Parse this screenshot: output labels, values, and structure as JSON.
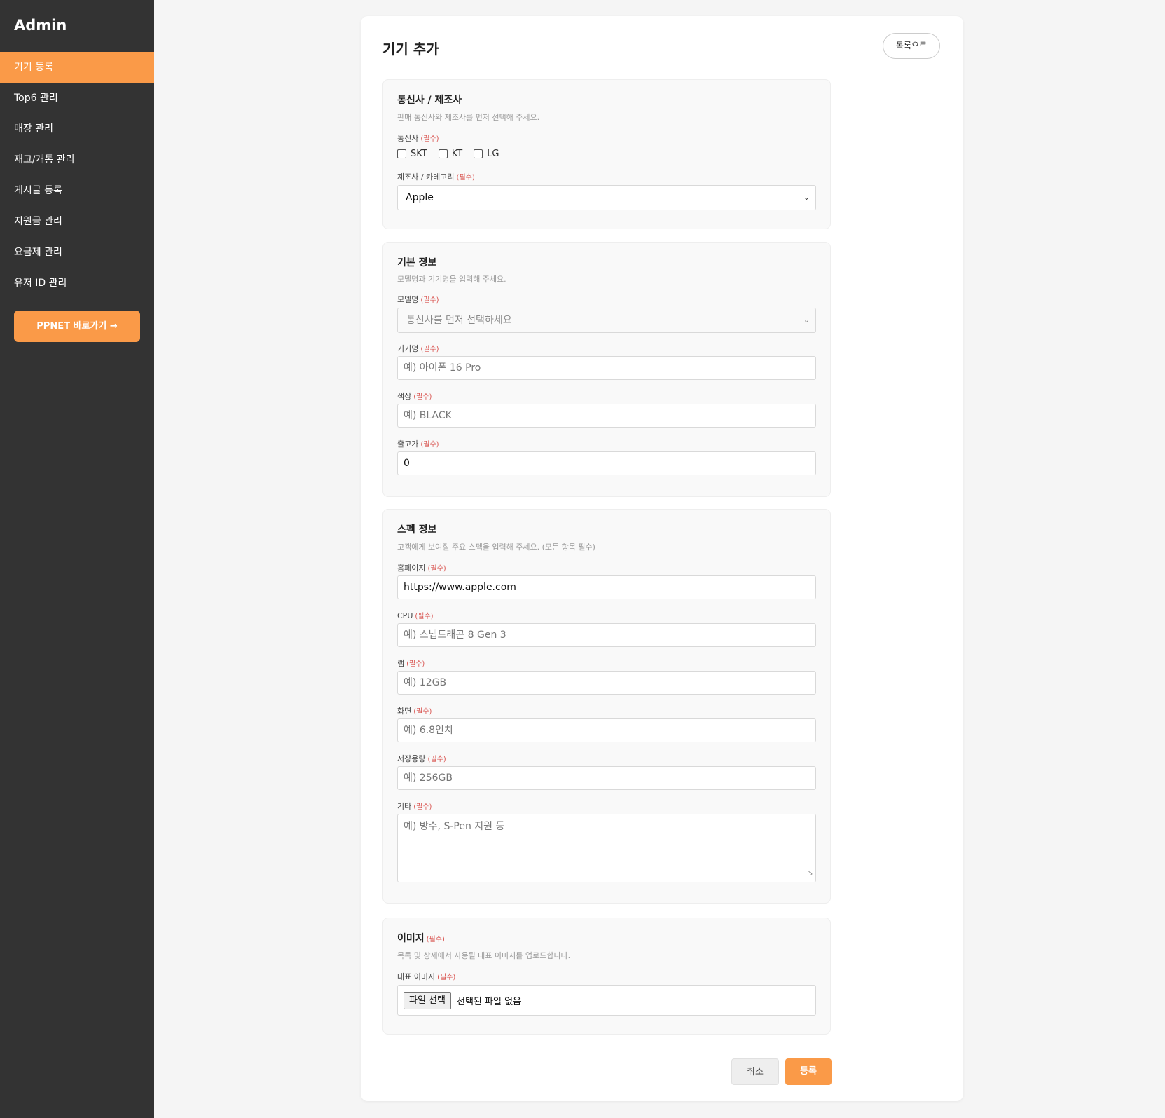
{
  "sidebar": {
    "brand": "Admin",
    "items": [
      {
        "label": "기기 등록"
      },
      {
        "label": "Top6 관리"
      },
      {
        "label": "매장 관리"
      },
      {
        "label": "재고/개통 관리"
      },
      {
        "label": "게시글 등록"
      },
      {
        "label": "지원금 관리"
      },
      {
        "label": "요금제 관리"
      },
      {
        "label": "유저 ID 관리"
      }
    ],
    "ppnet_button": "PPNET 바로가기 →"
  },
  "header": {
    "title": "기기 추가",
    "back_label": "목록으로"
  },
  "required_mark": "(필수)",
  "carrier_section": {
    "title": "통신사 / 제조사",
    "desc": "판매 통신사와 제조사를 먼저 선택해 주세요.",
    "carrier_label": "통신사",
    "carriers": [
      "SKT",
      "KT",
      "LG"
    ],
    "maker_label": "제조사 / 카테고리",
    "maker_value": "Apple"
  },
  "basic_section": {
    "title": "기본 정보",
    "desc": "모델명과 기기명을 입력해 주세요.",
    "model_label": "모델명",
    "model_value": "통신사를 먼저 선택하세요",
    "name_label": "기기명",
    "name_placeholder": "예) 아이폰 16 Pro",
    "color_label": "색상",
    "color_placeholder": "예) BLACK",
    "price_label": "출고가",
    "price_value": "0"
  },
  "spec_section": {
    "title": "스펙 정보",
    "desc": "고객에게 보여질 주요 스펙을 입력해 주세요. (모든 항목 필수)",
    "homepage_label": "홈페이지",
    "homepage_value": "https://www.apple.com",
    "cpu_label": "CPU",
    "cpu_placeholder": "예) 스냅드래곤 8 Gen 3",
    "ram_label": "램",
    "ram_placeholder": "예) 12GB",
    "screen_label": "화면",
    "screen_placeholder": "예) 6.8인치",
    "storage_label": "저장용량",
    "storage_placeholder": "예) 256GB",
    "etc_label": "기타",
    "etc_placeholder": "예) 방수, S-Pen 지원 등"
  },
  "image_section": {
    "title": "이미지",
    "desc": "목록 및 상세에서 사용될 대표 이미지를 업로드합니다.",
    "main_image_label": "대표 이미지",
    "file_button": "파일 선택",
    "file_status": "선택된 파일 없음"
  },
  "actions": {
    "cancel": "취소",
    "submit": "등록"
  },
  "colors": {
    "accent": "#fa9a48",
    "sidebar_bg": "#333333",
    "required": "#d9534f"
  }
}
